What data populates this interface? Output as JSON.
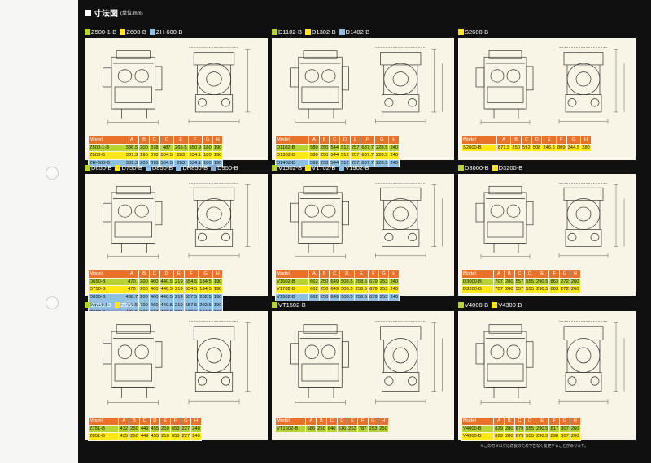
{
  "title": "寸法図",
  "title_unit": "(単位:mm)",
  "footnote": "※このカタログは改良のため予告なく変更することがあります。",
  "columns": [
    "Model",
    "A",
    "B",
    "C",
    "D",
    "E",
    "F",
    "G",
    "H"
  ],
  "colors": {
    "green": "#b8d433",
    "yellow": "#ffe815",
    "blue": "#8fc0e4",
    "purple": "#8aa6d8",
    "orange": "#e8722a",
    "cream": "#f8f5e6",
    "black": "#101010"
  },
  "panels": [
    {
      "tags": [
        {
          "label": "Z500-1-B",
          "color": "green"
        },
        {
          "label": "Z600-B",
          "color": "yellow"
        },
        {
          "label": "ZH-600-B",
          "color": "blue"
        }
      ],
      "rows": [
        [
          "Z500-1-B",
          "386.5",
          "200",
          "378",
          "487",
          "265.5",
          "550.9",
          "180",
          "190"
        ],
        [
          "Z600-B",
          "387.3",
          "195",
          "378",
          "504.5",
          "283",
          "534.1",
          "180",
          "190"
        ],
        [
          "ZH-600-B",
          "389.3",
          "200",
          "378",
          "504.5",
          "283",
          "534.1",
          "180",
          "190"
        ]
      ],
      "row_colors": [
        "green",
        "yellow",
        "blue"
      ]
    },
    {
      "tags": [
        {
          "label": "D1102-B",
          "color": "green"
        },
        {
          "label": "D1302-B",
          "color": "yellow"
        },
        {
          "label": "D1402-B",
          "color": "blue"
        }
      ],
      "rows": [
        [
          "D1102-B",
          "580",
          "250",
          "544",
          "512",
          "257",
          "637.7",
          "228.5",
          "240"
        ],
        [
          "D1302-B",
          "580",
          "250",
          "544",
          "512",
          "257",
          "637.7",
          "228.5",
          "240"
        ],
        [
          "D1402-B",
          "568",
          "250",
          "544",
          "512",
          "257",
          "637.7",
          "228.5",
          "240"
        ]
      ],
      "row_colors": [
        "green",
        "yellow",
        "blue"
      ]
    },
    {
      "tags": [
        {
          "label": "S2600-B",
          "color": "yellow"
        }
      ],
      "rows": [
        [
          "S2600-B",
          "871.5",
          "250",
          "592",
          "508",
          "246.5",
          "809",
          "344.5",
          "280"
        ]
      ],
      "row_colors": [
        "yellow"
      ]
    },
    {
      "tags": [
        {
          "label": "D650-B",
          "color": "green"
        },
        {
          "label": "D750-B",
          "color": "yellow"
        },
        {
          "label": "D850-B",
          "color": "blue"
        },
        {
          "label": "DH850-B",
          "color": "blue"
        },
        {
          "label": "D950-B",
          "color": "purple"
        }
      ],
      "rows": [
        [
          "D650-B",
          "470",
          "200",
          "460",
          "440.5",
          "219",
          "554.5",
          "184.5",
          "190"
        ],
        [
          "D750-B",
          "470",
          "200",
          "460",
          "440.5",
          "219",
          "554.5",
          "184.5",
          "190"
        ],
        [
          "D850-B",
          "468.7",
          "200",
          "460",
          "440.5",
          "219",
          "557.5",
          "202.5",
          "190"
        ],
        [
          "DH850-B",
          "477.5",
          "200",
          "460",
          "440.5",
          "219",
          "557.5",
          "202.5",
          "190"
        ],
        [
          "D950-B",
          "477.5",
          "200",
          "462",
          "426.5",
          "201",
          "538.5",
          "184.5",
          "190"
        ]
      ],
      "row_colors": [
        "green",
        "yellow",
        "blue",
        "blue",
        "purple"
      ]
    },
    {
      "tags": [
        {
          "label": "V1502-B",
          "color": "green"
        },
        {
          "label": "V1702-B",
          "color": "yellow"
        },
        {
          "label": "V1902-B",
          "color": "blue"
        }
      ],
      "rows": [
        [
          "V1502-B",
          "662",
          "250",
          "649",
          "508.5",
          "258.5",
          "679",
          "253",
          "240"
        ],
        [
          "V1702-B",
          "662",
          "250",
          "649",
          "508.5",
          "258.5",
          "679",
          "253",
          "240"
        ],
        [
          "V1902-B",
          "662",
          "250",
          "649",
          "508.5",
          "258.5",
          "679",
          "253",
          "240"
        ]
      ],
      "row_colors": [
        "green",
        "yellow",
        "blue"
      ]
    },
    {
      "tags": [
        {
          "label": "D3000-B",
          "color": "green"
        },
        {
          "label": "D3200-B",
          "color": "yellow"
        }
      ],
      "rows": [
        [
          "D3000-B",
          "707",
          "280",
          "557",
          "555",
          "290.5",
          "863",
          "272",
          "260"
        ],
        [
          "D3200-B",
          "707",
          "280",
          "557",
          "555",
          "290.5",
          "863",
          "272",
          "260"
        ]
      ],
      "row_colors": [
        "green",
        "yellow"
      ]
    },
    {
      "tags": [
        {
          "label": "Z751-B",
          "color": "green"
        },
        {
          "label": "Z851-B",
          "color": "yellow"
        }
      ],
      "rows": [
        [
          "Z751-B",
          "432",
          "250",
          "449",
          "455",
          "210",
          "653",
          "227",
          "240"
        ],
        [
          "Z851-B",
          "435",
          "250",
          "449",
          "455",
          "210",
          "653",
          "227",
          "240"
        ]
      ],
      "row_colors": [
        "green",
        "yellow"
      ]
    },
    {
      "tags": [
        {
          "label": "VT1502-B",
          "color": "green"
        }
      ],
      "rows": [
        [
          "VT1502-B",
          "686",
          "250",
          "640",
          "516",
          "253",
          "787",
          "253",
          "250"
        ]
      ],
      "row_colors": [
        "green"
      ]
    },
    {
      "tags": [
        {
          "label": "V4000-B",
          "color": "green"
        },
        {
          "label": "V4300-B",
          "color": "yellow"
        }
      ],
      "rows": [
        [
          "V4000-B",
          "829",
          "280",
          "679",
          "555",
          "290.5",
          "817",
          "307",
          "260"
        ],
        [
          "V4300-B",
          "829",
          "280",
          "679",
          "555",
          "290.5",
          "898",
          "307",
          "260"
        ]
      ],
      "row_colors": [
        "green",
        "yellow"
      ]
    }
  ]
}
